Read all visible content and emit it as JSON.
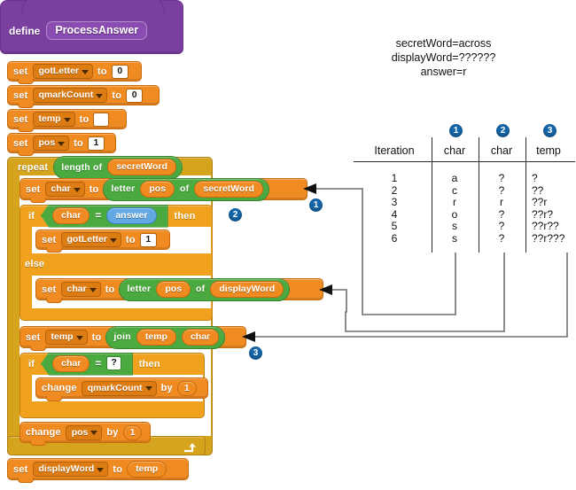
{
  "script": {
    "define_label": "define",
    "proc_name": "ProcessAnswer",
    "blocks": {
      "set_gotletter": {
        "cmd": "set",
        "var": "gotLetter",
        "to": "to",
        "value": "0"
      },
      "set_qmarkcount": {
        "cmd": "set",
        "var": "qmarkCount",
        "to": "to",
        "value": "0"
      },
      "set_temp_empty": {
        "cmd": "set",
        "var": "temp",
        "to": "to",
        "value": ""
      },
      "set_pos": {
        "cmd": "set",
        "var": "pos",
        "to": "to",
        "value": "1"
      },
      "repeat": {
        "cmd": "repeat",
        "length_of": "length of",
        "operand": "secretWord"
      },
      "set_char_secret": {
        "cmd": "set",
        "var": "char",
        "to": "to",
        "letter": "letter",
        "pos": "pos",
        "of": "of",
        "word": "secretWord"
      },
      "if_char_answer": {
        "cmd": "if",
        "left": "char",
        "op": "=",
        "right": "answer",
        "then": "then"
      },
      "set_gotletter_1": {
        "cmd": "set",
        "var": "gotLetter",
        "to": "to",
        "value": "1"
      },
      "else": {
        "cmd": "else"
      },
      "set_char_display": {
        "cmd": "set",
        "var": "char",
        "to": "to",
        "letter": "letter",
        "pos": "pos",
        "of": "of",
        "word": "displayWord"
      },
      "set_temp_join": {
        "cmd": "set",
        "var": "temp",
        "to": "to",
        "join": "join",
        "arg1": "temp",
        "arg2": "char"
      },
      "if_char_qmark": {
        "cmd": "if",
        "left": "char",
        "op": "=",
        "right": "?",
        "then": "then"
      },
      "change_qmarkcount": {
        "cmd": "change",
        "var": "qmarkCount",
        "by": "by",
        "value": "1"
      },
      "change_pos": {
        "cmd": "change",
        "var": "pos",
        "by": "by",
        "value": "1"
      },
      "set_displayword": {
        "cmd": "set",
        "var": "displayWord",
        "to": "to",
        "value": "temp"
      }
    }
  },
  "legend": {
    "lines": [
      "secretWord=across",
      "displayWord=??????",
      "answer=r"
    ]
  },
  "markers": {
    "one": "1",
    "two": "2",
    "three": "3"
  },
  "table": {
    "headers": [
      "Iteration",
      "char",
      "char",
      "temp"
    ],
    "marker_labels": [
      "1",
      "2",
      "3"
    ],
    "rows": [
      {
        "iteration": "1",
        "char1": "a",
        "char2": "?",
        "temp": "?"
      },
      {
        "iteration": "2",
        "char1": "c",
        "char2": "?",
        "temp": "??"
      },
      {
        "iteration": "3",
        "char1": "r",
        "char2": "r",
        "temp": "??r"
      },
      {
        "iteration": "4",
        "char1": "o",
        "char2": "?",
        "temp": "??r?"
      },
      {
        "iteration": "5",
        "char1": "s",
        "char2": "?",
        "temp": "??r??"
      },
      {
        "iteration": "6",
        "char1": "s",
        "char2": "?",
        "temp": "??r???"
      }
    ]
  },
  "colors": {
    "variable_orange": "#f08b21",
    "operator_green": "#4aa93f",
    "control_mustard": "#d6a41c",
    "control_orange": "#f0a21f",
    "custom_purple": "#7b3fa0",
    "parameter_blue": "#62a9e3",
    "marker_blue": "#1565a8",
    "wire_gray": "#6f6f6f"
  }
}
